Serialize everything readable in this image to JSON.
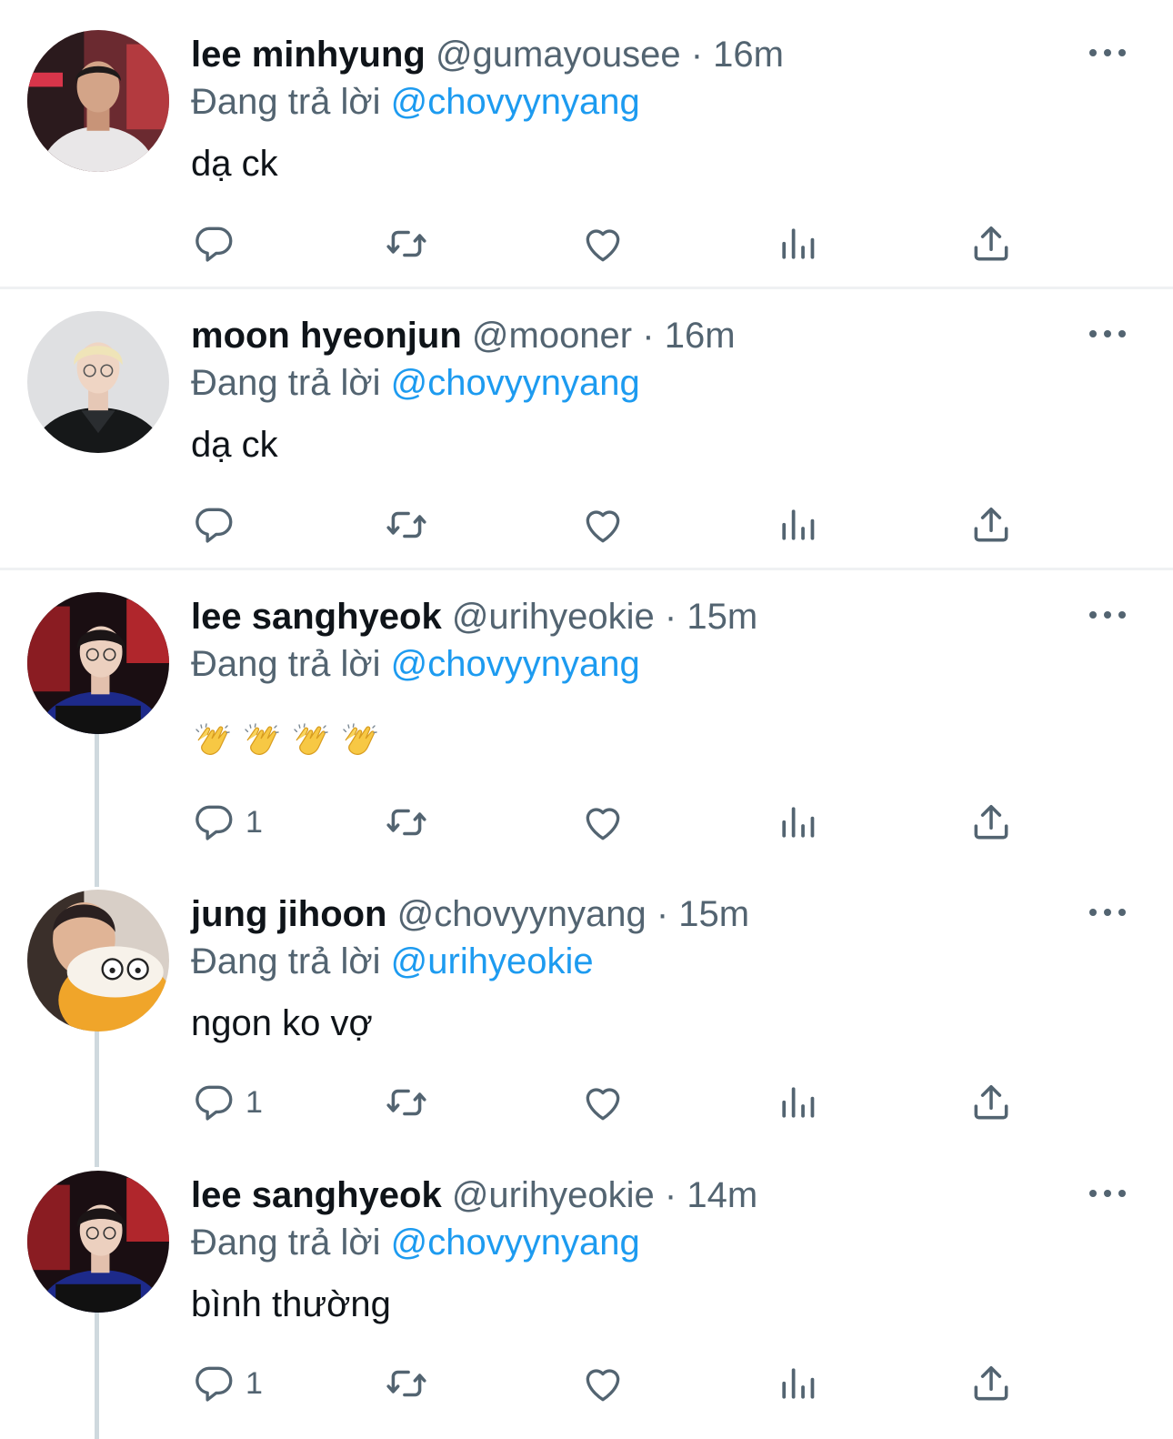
{
  "colors": {
    "link": "#1d9bf0",
    "secondary": "#536471",
    "primary": "#0f1419",
    "divider": "#eff1f3",
    "thread_line": "#cfd9de"
  },
  "tweets": [
    {
      "name": "lee minhyung",
      "handle": "@gumayousee",
      "sep": "·",
      "time": "16m",
      "replying_prefix": "Đang trả lời",
      "replying_to": "@chovyynyang",
      "text": "dạ ck",
      "reply_count": ""
    },
    {
      "name": "moon hyeonjun",
      "handle": "@mooner",
      "sep": "·",
      "time": "16m",
      "replying_prefix": "Đang trả lời",
      "replying_to": "@chovyynyang",
      "text": "dạ ck",
      "reply_count": ""
    },
    {
      "name": "lee sanghyeok",
      "handle": "@urihyeokie",
      "sep": "·",
      "time": "15m",
      "replying_prefix": "Đang trả lời",
      "replying_to": "@chovyynyang",
      "text": "👏👏👏👏",
      "reply_count": "1"
    },
    {
      "name": "jung jihoon",
      "handle": "@chovyynyang",
      "sep": "·",
      "time": "15m",
      "replying_prefix": "Đang trả lời",
      "replying_to": "@urihyeokie",
      "text": "ngon ko vợ",
      "reply_count": "1"
    },
    {
      "name": "lee sanghyeok",
      "handle": "@urihyeokie",
      "sep": "·",
      "time": "14m",
      "replying_prefix": "Đang trả lời",
      "replying_to": "@chovyynyang",
      "text": "bình thường",
      "reply_count": "1"
    }
  ],
  "icons": [
    "reply-icon",
    "retweet-icon",
    "like-icon",
    "views-icon",
    "share-icon",
    "more-icon",
    "clap-emoji-icon"
  ]
}
